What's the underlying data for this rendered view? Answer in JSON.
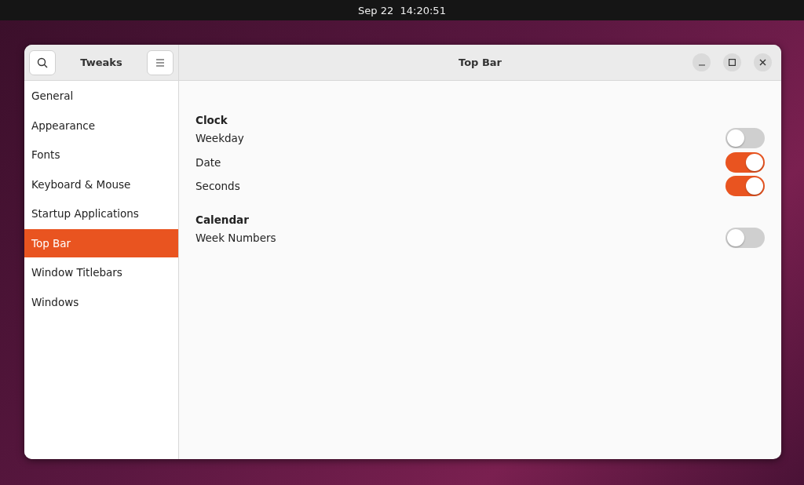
{
  "top_bar": {
    "clock": "Sep 22  14:20:51"
  },
  "window": {
    "sidebar_title": "Tweaks",
    "title": "Top Bar"
  },
  "sidebar": {
    "items": [
      {
        "label": "General",
        "selected": false
      },
      {
        "label": "Appearance",
        "selected": false
      },
      {
        "label": "Fonts",
        "selected": false
      },
      {
        "label": "Keyboard & Mouse",
        "selected": false
      },
      {
        "label": "Startup Applications",
        "selected": false
      },
      {
        "label": "Top Bar",
        "selected": true
      },
      {
        "label": "Window Titlebars",
        "selected": false
      },
      {
        "label": "Windows",
        "selected": false
      }
    ]
  },
  "sections": [
    {
      "title": "Clock",
      "rows": [
        {
          "label": "Weekday",
          "on": false
        },
        {
          "label": "Date",
          "on": true
        },
        {
          "label": "Seconds",
          "on": true
        }
      ]
    },
    {
      "title": "Calendar",
      "rows": [
        {
          "label": "Week Numbers",
          "on": false
        }
      ]
    }
  ]
}
